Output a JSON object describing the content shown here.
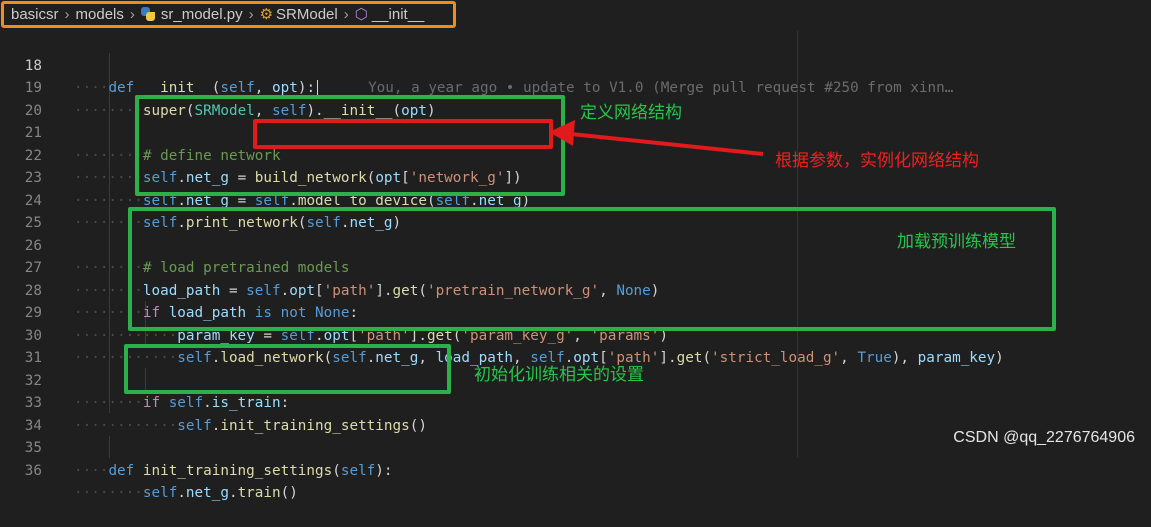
{
  "breadcrumb": {
    "items": [
      "basicsr",
      "models",
      "sr_model.py",
      "SRModel",
      "__init__"
    ],
    "separator": ">"
  },
  "lines": [
    {
      "num": "18"
    },
    {
      "num": "19"
    },
    {
      "num": "20"
    },
    {
      "num": "21"
    },
    {
      "num": "22"
    },
    {
      "num": "23"
    },
    {
      "num": "24"
    },
    {
      "num": "25"
    },
    {
      "num": "26"
    },
    {
      "num": "27"
    },
    {
      "num": "28"
    },
    {
      "num": "29"
    },
    {
      "num": "30"
    },
    {
      "num": "31"
    },
    {
      "num": "32"
    },
    {
      "num": "33"
    },
    {
      "num": "34"
    },
    {
      "num": "35"
    },
    {
      "num": "36"
    }
  ],
  "code": {
    "l18": {
      "def": "def",
      "name": "__init__",
      "p1": "(",
      "self": "self",
      "c": ", ",
      "arg": "opt",
      "p2": "):"
    },
    "l19": {
      "fn": "super",
      "p1": "(",
      "cls": "SRModel",
      "c": ", ",
      "self": "self",
      "p2": ").",
      "m": "__init__",
      "p3": "(",
      "arg": "opt",
      "p4": ")"
    },
    "l21": {
      "comment": "# define network"
    },
    "l22": {
      "self": "self",
      "dot": ".",
      "var": "net_g",
      "eq": " = ",
      "fn": "build_network",
      "p1": "(",
      "arg": "opt",
      "p2": "[",
      "str": "'network_g'",
      "p3": "])"
    },
    "l23": {
      "self": "self",
      "dot": ".",
      "var": "net_g",
      "eq": " = ",
      "self2": "self",
      "dot2": ".",
      "fn": "model_to_device",
      "p1": "(",
      "self3": "self",
      "dot3": ".",
      "var2": "net_g",
      "p2": ")"
    },
    "l24": {
      "self": "self",
      "dot": ".",
      "fn": "print_network",
      "p1": "(",
      "self2": "self",
      "dot2": ".",
      "var": "net_g",
      "p2": ")"
    },
    "l26": {
      "comment": "# load pretrained models"
    },
    "l27": {
      "var": "load_path",
      "eq": " = ",
      "self": "self",
      "dot": ".",
      "var2": "opt",
      "p1": "[",
      "str": "'path'",
      "p2": "].",
      "fn": "get",
      "p3": "(",
      "str2": "'pretrain_network_g'",
      "c": ", ",
      "none": "None",
      "p4": ")"
    },
    "l28": {
      "if": "if",
      "var": " load_path",
      "is": " is not ",
      "none": "None",
      "colon": ":"
    },
    "l29": {
      "var": "param_key",
      "eq": " = ",
      "self": "self",
      "dot": ".",
      "var2": "opt",
      "p1": "[",
      "str": "'path'",
      "p2": "].",
      "fn": "get",
      "p3": "(",
      "str2": "'param_key_g'",
      "c": ", ",
      "str3": "'params'",
      "p4": ")"
    },
    "l30": {
      "self": "self",
      "dot": ".",
      "fn": "load_network",
      "p1": "(",
      "self2": "self",
      "dot2": ".",
      "var": "net_g",
      "c1": ", ",
      "var2": "load_path",
      "c2": ", ",
      "self3": "self",
      "dot3": ".",
      "var3": "opt",
      "p2": "[",
      "str": "'path'",
      "p3": "].",
      "fn2": "get",
      "p4": "(",
      "str2": "'strict_load_g'",
      "c3": ", ",
      "tr": "True",
      "p5": "), ",
      "var4": "param_key",
      "p6": ")"
    },
    "l32": {
      "if": "if",
      "sp": " ",
      "self": "self",
      "dot": ".",
      "var": "is_train",
      "colon": ":"
    },
    "l33": {
      "self": "self",
      "dot": ".",
      "fn": "init_training_settings",
      "p": "()"
    },
    "l35": {
      "def": "def",
      "name": "init_training_settings",
      "p1": "(",
      "self": "self",
      "p2": "):"
    },
    "l36": {
      "self": "self",
      "dot": ".",
      "var": "net_g",
      "dot2": ".",
      "fn": "train",
      "p": "()"
    }
  },
  "blame": "You, a year ago • update to V1.0 (Merge pull request #250 from xinn…",
  "annotations": {
    "define_network": "定义网络结构",
    "instantiate": "根据参数，实例化网络结构",
    "load_pretrained": "加载预训练模型",
    "init_settings": "初始化训练相关的设置"
  },
  "watermark": "CSDN @qq_2276764906",
  "colors": {
    "annotation_green": "#2bb04a",
    "annotation_red": "#e11b1b",
    "breadcrumb_highlight": "#f08c1a"
  }
}
